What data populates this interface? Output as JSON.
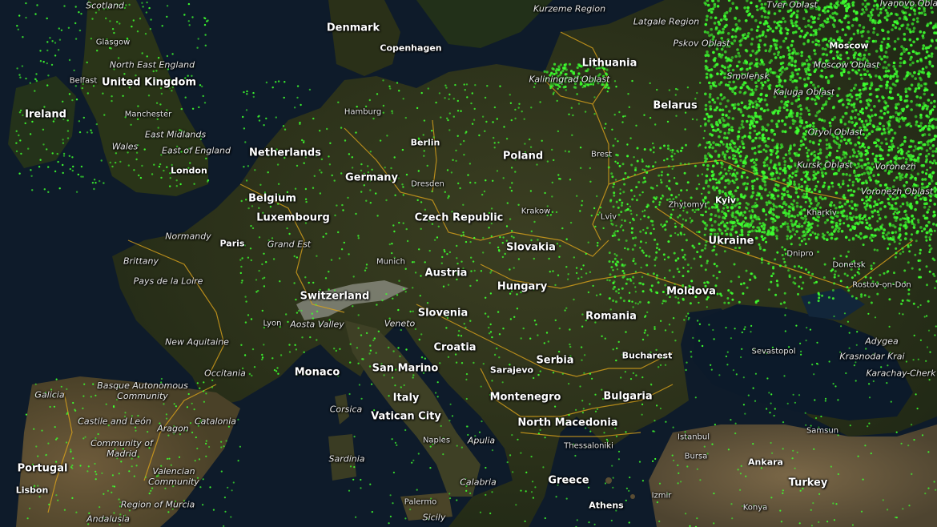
{
  "map": {
    "view": "satellite",
    "colors": {
      "sea": "#0e1b2a",
      "land_dark": "#1f2a17",
      "land_olive": "#3a3f22",
      "land_arid": "#6b5a3a",
      "border": "#d9a21b",
      "points": "#3dff2f",
      "mountains": "#cfcfcf"
    },
    "labels": {
      "countries": [
        "Denmark",
        "United Kingdom",
        "Ireland",
        "Netherlands",
        "Belgium",
        "Luxembourg",
        "Germany",
        "Czech Republic",
        "Poland",
        "Lithuania",
        "Belarus",
        "Ukraine",
        "Slovakia",
        "Austria",
        "Hungary",
        "Switzerland",
        "Slovenia",
        "Croatia",
        "Moldova",
        "Romania",
        "Serbia",
        "Monaco",
        "San Marino",
        "Italy",
        "Vatican City",
        "Montenegro",
        "Bulgaria",
        "North Macedonia",
        "Greece",
        "Portugal",
        "Turkey"
      ],
      "regions": [
        "Scotland",
        "North East England",
        "East Midlands",
        "Wales",
        "East of England",
        "Normandy",
        "Grand Est",
        "Brittany",
        "Pays de la Loire",
        "Aosta Valley",
        "Veneto",
        "New Aquitaine",
        "Occitania",
        "Basque Autonomous Community",
        "Galicia",
        "Castile and León",
        "Aragon",
        "Catalonia",
        "Community of Madrid",
        "Valencian Community",
        "Region of Murcia",
        "Andalusia",
        "Corsica",
        "Sardinia",
        "Apulia",
        "Calabria",
        "Sicily",
        "Kurzeme Region",
        "Latgale Region",
        "Tver Oblast",
        "Ivanovo Oblast",
        "Pskov Oblast",
        "Kaliningrad Oblast",
        "Moscow Oblast",
        "Smolensk",
        "Kaluga Oblast",
        "Oryol Oblast",
        "Kursk Oblast",
        "Voronezh",
        "Voronezh Oblast",
        "Adygea",
        "Krasnodar Krai",
        "Karachay-Cherk"
      ],
      "cities": [
        "Copenhagen",
        "Glasgow",
        "Belfast",
        "Manchester",
        "London",
        "Hamburg",
        "Berlin",
        "Dresden",
        "Paris",
        "Munich",
        "Lyon",
        "Krakow",
        "Lviv",
        "Brest",
        "Moscow",
        "Zhytomyr",
        "Kyiv",
        "Kharkiv",
        "Dnipro",
        "Donetsk",
        "Rostov-on-Don",
        "Sevastopol",
        "Bucharest",
        "Sarajevo",
        "Naples",
        "Palermo",
        "Thessaloniki",
        "Athens",
        "Istanbul",
        "Bursa",
        "Izmir",
        "Konya",
        "Ankara",
        "Samsun",
        "Lisbon"
      ]
    }
  }
}
